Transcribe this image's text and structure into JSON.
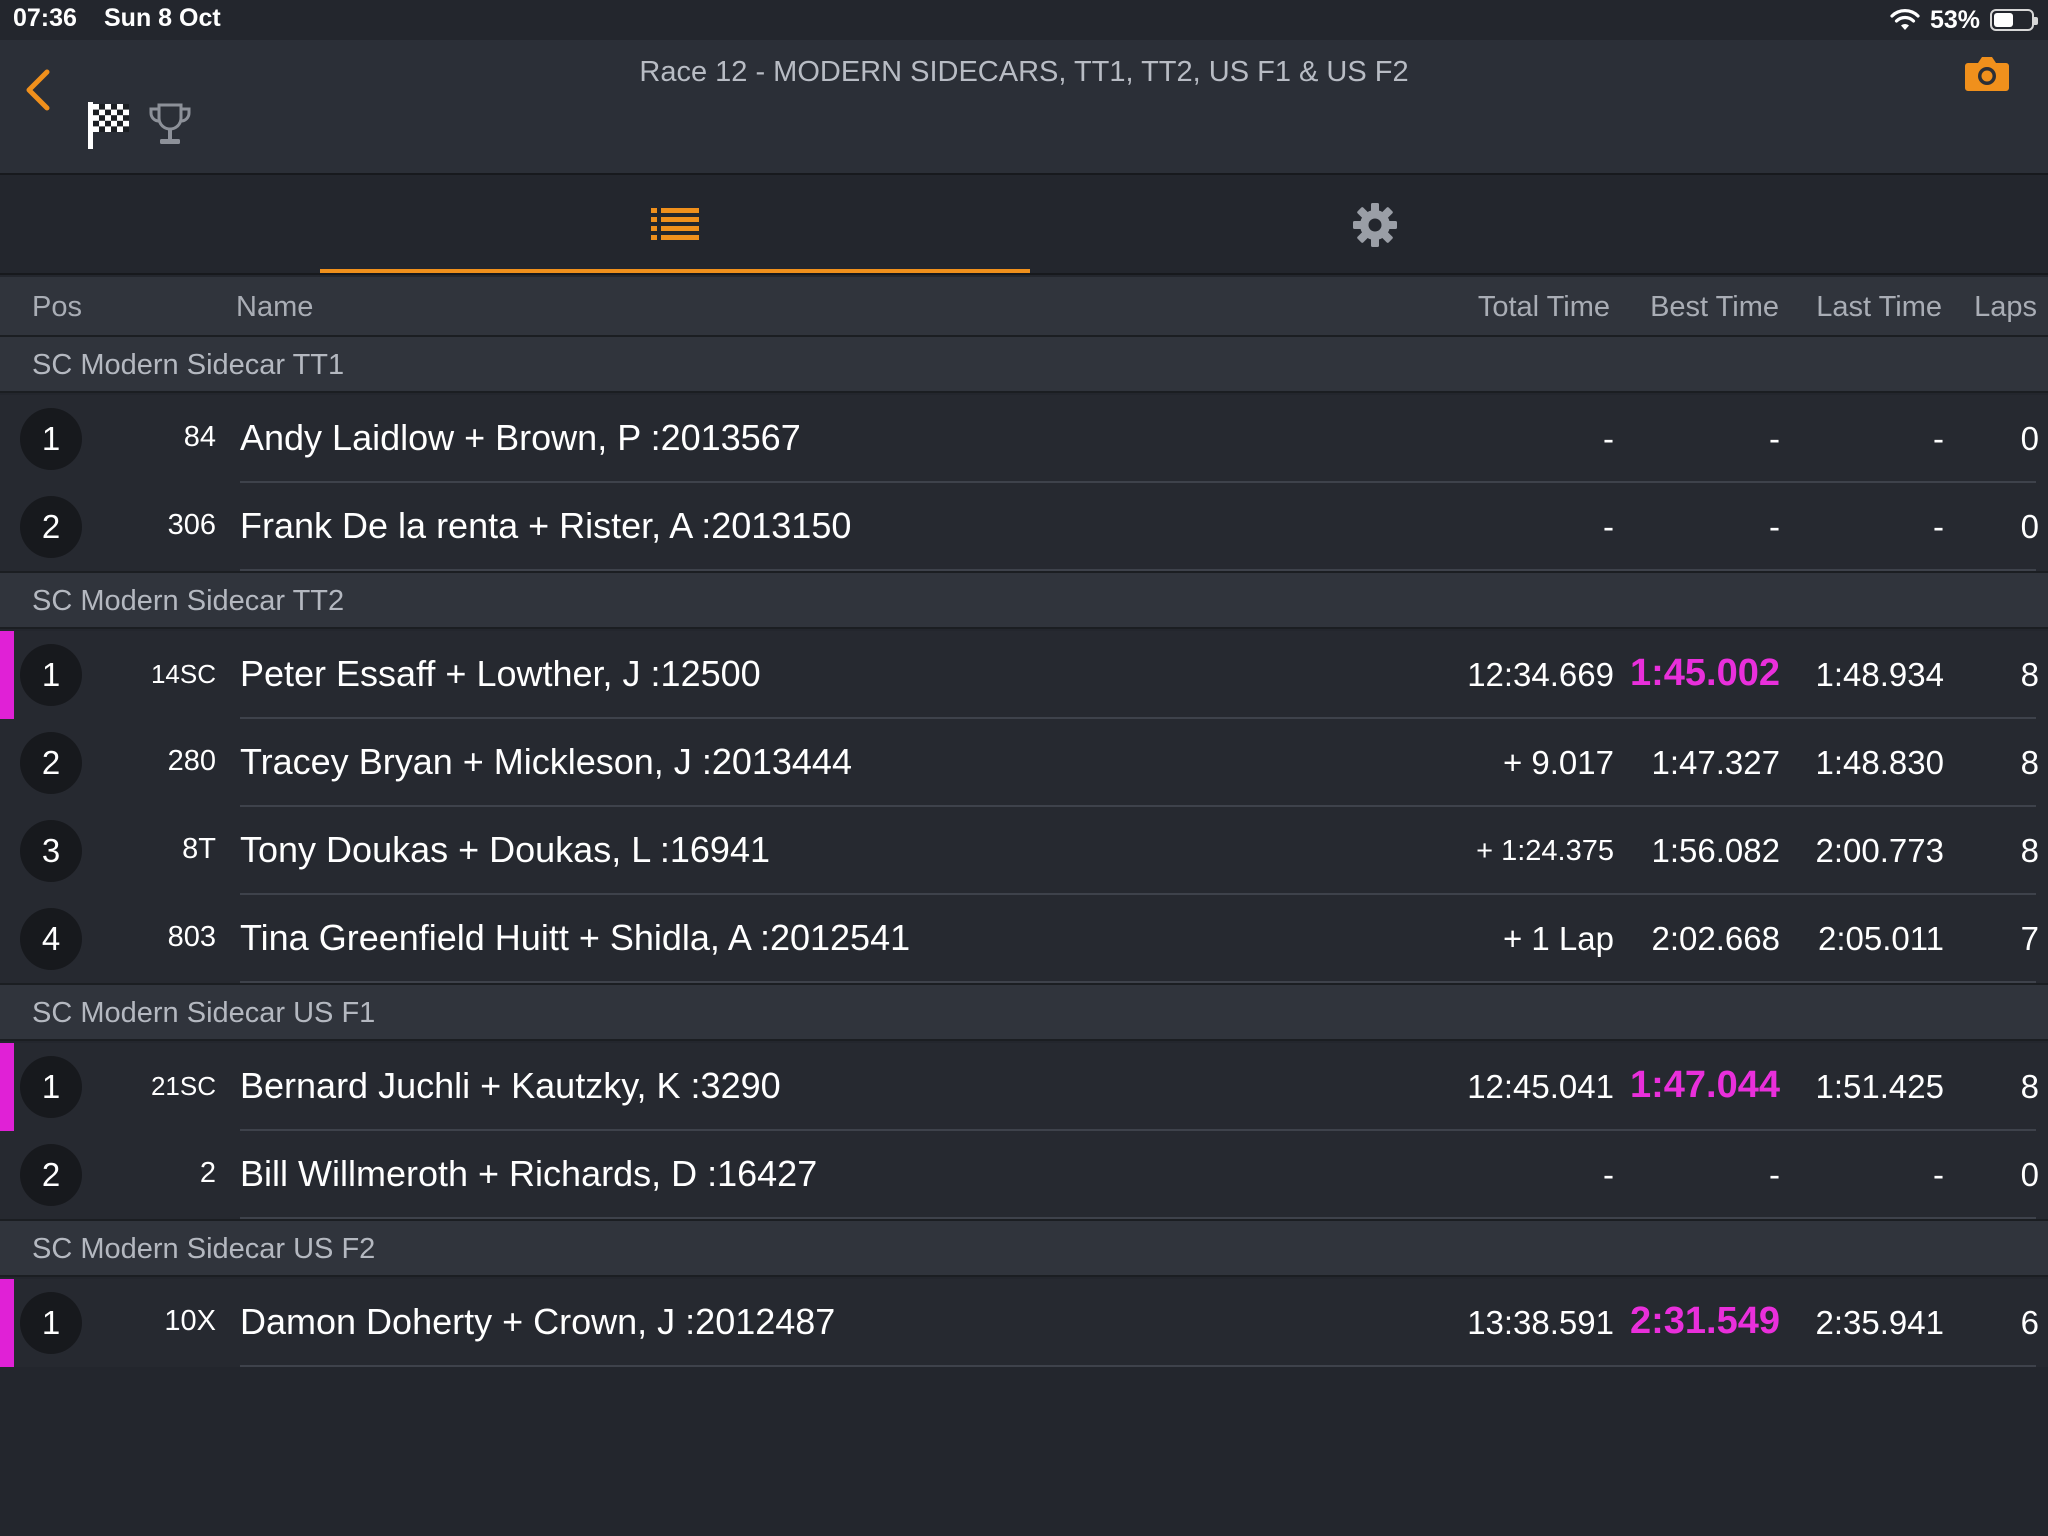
{
  "status_bar": {
    "time": "07:36",
    "date": "Sun 8 Oct",
    "battery_pct": "53%",
    "battery_level": 0.53
  },
  "header": {
    "title": "Race 12 - MODERN SIDECARS, TT1, TT2, US F1 & US F2"
  },
  "colors": {
    "accent": "#f0901c",
    "best_lap": "#e92fdb",
    "background": "#23262d"
  },
  "tabs": [
    {
      "icon": "list-icon",
      "selected": true
    },
    {
      "icon": "gear-icon",
      "selected": false
    }
  ],
  "columns": {
    "pos": "Pos",
    "name": "Name",
    "total": "Total Time",
    "best": "Best Time",
    "last": "Last Time",
    "laps": "Laps"
  },
  "sections": [
    {
      "label": "SC Modern Sidecar TT1",
      "rows": [
        {
          "pos": "1",
          "num": "84",
          "name": "Andy Laidlow + Brown, P :2013567",
          "total": "-",
          "best": "-",
          "last": "-",
          "laps": "0",
          "leader": false
        },
        {
          "pos": "2",
          "num": "306",
          "name": "Frank De la renta + Rister, A :2013150",
          "total": "-",
          "best": "-",
          "last": "-",
          "laps": "0",
          "leader": false
        }
      ]
    },
    {
      "label": "SC Modern Sidecar TT2",
      "rows": [
        {
          "pos": "1",
          "num": "14SC",
          "name": "Peter Essaff + Lowther, J :12500",
          "total": "12:34.669",
          "best": "1:45.002",
          "last": "1:48.934",
          "laps": "8",
          "leader": true
        },
        {
          "pos": "2",
          "num": "280",
          "name": "Tracey Bryan + Mickleson, J :2013444",
          "total": "+ 9.017",
          "best": "1:47.327",
          "last": "1:48.830",
          "laps": "8",
          "leader": false
        },
        {
          "pos": "3",
          "num": "8T",
          "name": "Tony Doukas + Doukas, L :16941",
          "total": "+ 1:24.375",
          "best": "1:56.082",
          "last": "2:00.773",
          "laps": "8",
          "leader": false
        },
        {
          "pos": "4",
          "num": "803",
          "name": "Tina Greenfield Huitt + Shidla, A :2012541",
          "total": "+ 1 Lap",
          "best": "2:02.668",
          "last": "2:05.011",
          "laps": "7",
          "leader": false
        }
      ]
    },
    {
      "label": "SC Modern Sidecar US F1",
      "rows": [
        {
          "pos": "1",
          "num": "21SC",
          "name": "Bernard Juchli + Kautzky, K :3290",
          "total": "12:45.041",
          "best": "1:47.044",
          "last": "1:51.425",
          "laps": "8",
          "leader": true
        },
        {
          "pos": "2",
          "num": "2",
          "name": "Bill Willmeroth + Richards, D :16427",
          "total": "-",
          "best": "-",
          "last": "-",
          "laps": "0",
          "leader": false
        }
      ]
    },
    {
      "label": "SC Modern Sidecar US F2",
      "rows": [
        {
          "pos": "1",
          "num": "10X",
          "name": "Damon Doherty + Crown, J :2012487",
          "total": "13:38.591",
          "best": "2:31.549",
          "last": "2:35.941",
          "laps": "6",
          "leader": true
        }
      ]
    }
  ]
}
